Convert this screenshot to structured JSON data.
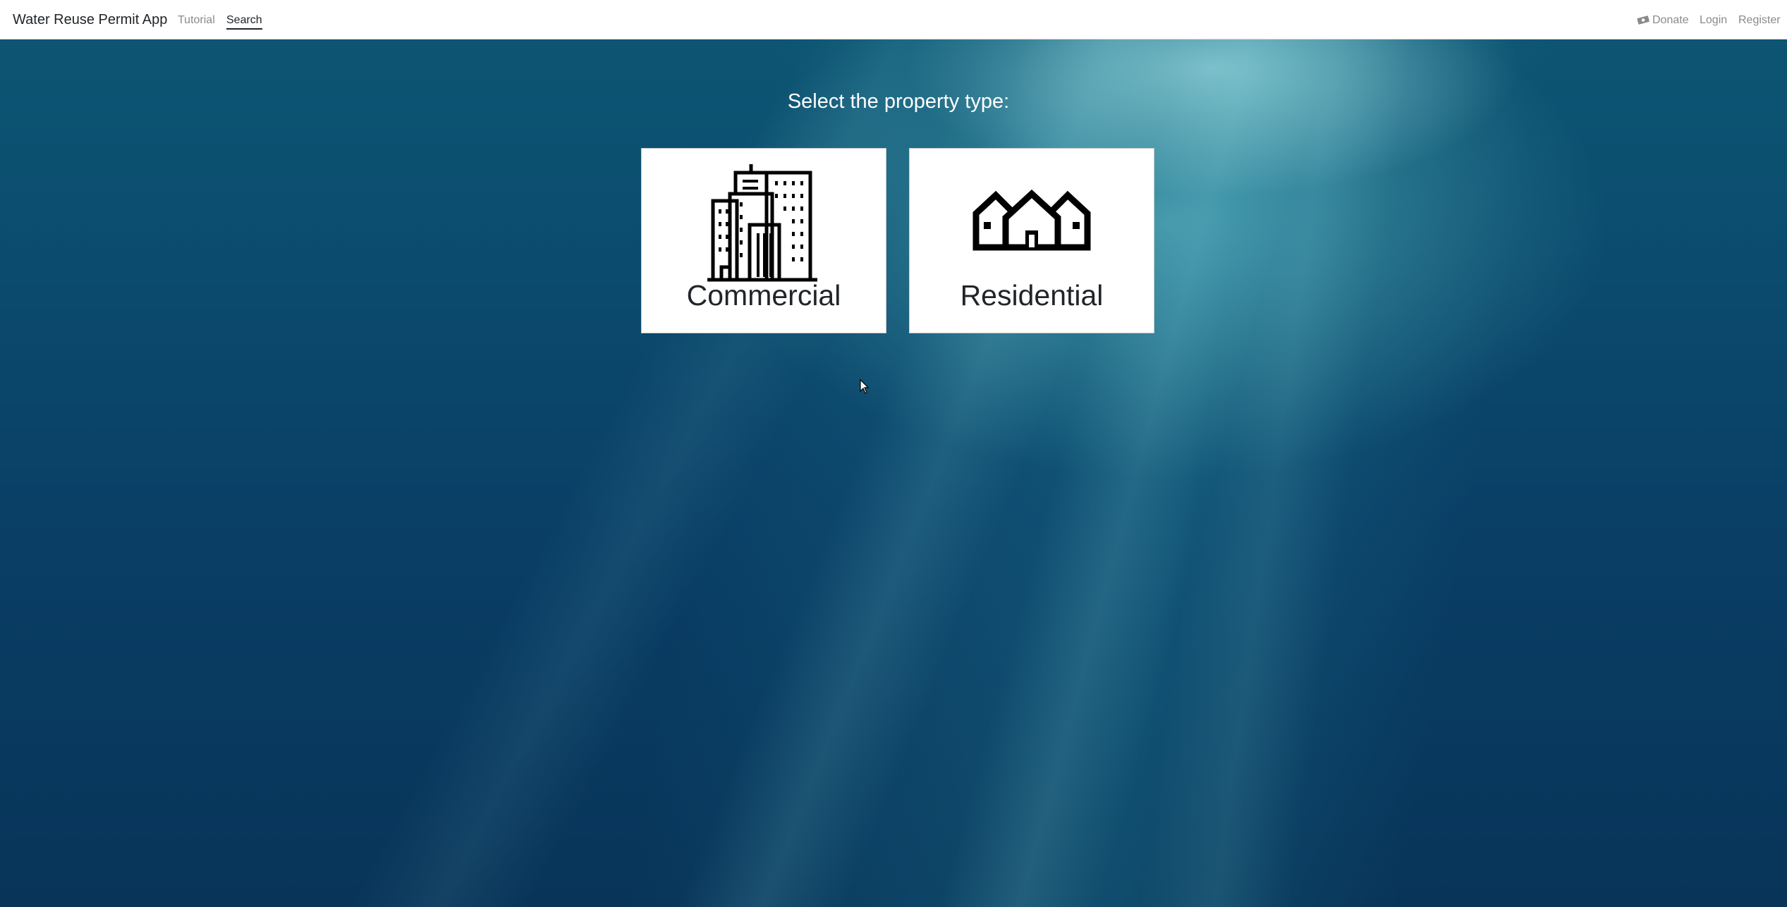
{
  "navbar": {
    "brand": "Water Reuse Permit App",
    "links": [
      {
        "label": "Tutorial",
        "active": false
      },
      {
        "label": "Search",
        "active": true
      }
    ],
    "right": {
      "donate_label": "Donate",
      "donate_icon": "money-bill-icon",
      "login_label": "Login",
      "register_label": "Register"
    }
  },
  "main": {
    "heading": "Select the property type:",
    "options": [
      {
        "label": "Commercial",
        "icon": "office-buildings-icon"
      },
      {
        "label": "Residential",
        "icon": "houses-icon"
      }
    ]
  },
  "colors": {
    "background_top": "#0d5573",
    "background_bottom": "#083459",
    "card": "#ffffff",
    "text_dark": "#212529",
    "nav_muted": "#8a8a8a"
  }
}
